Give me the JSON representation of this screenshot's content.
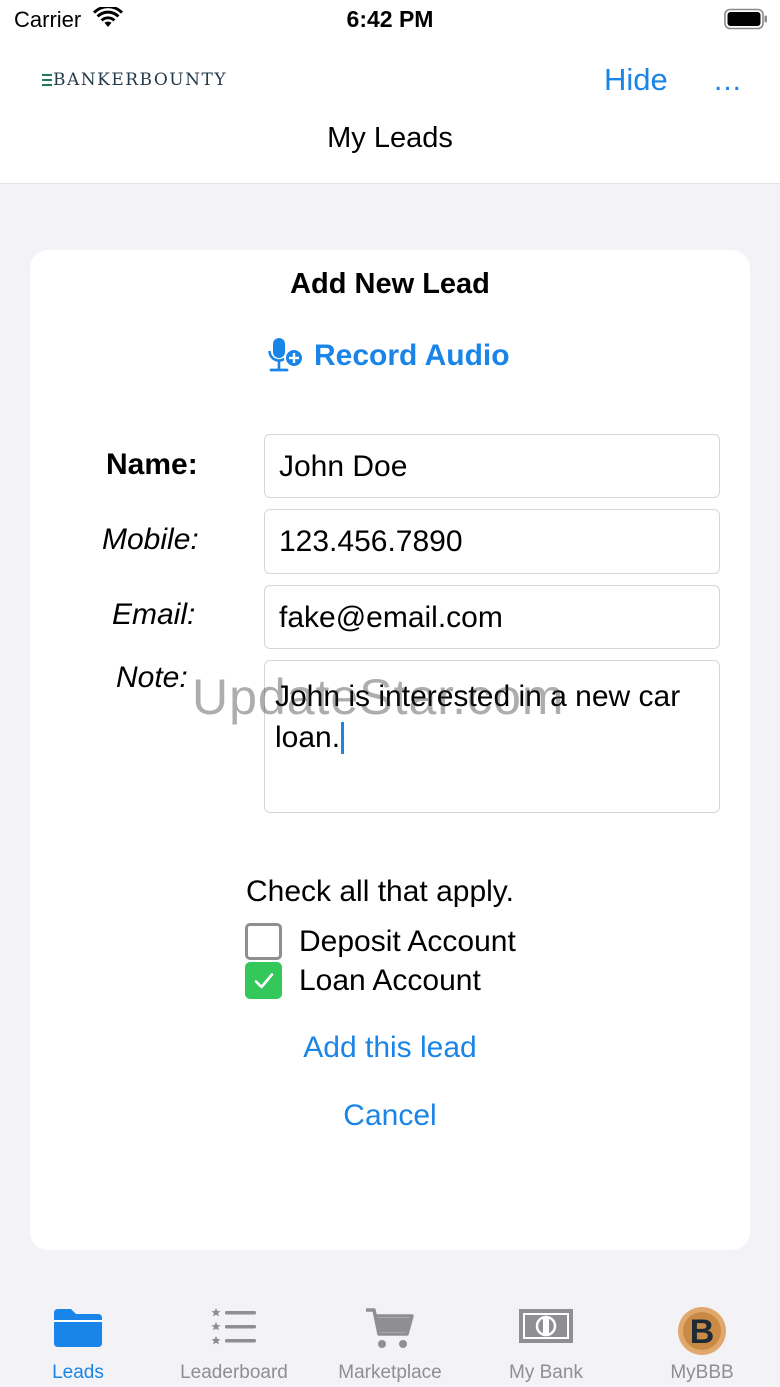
{
  "status_bar": {
    "carrier": "Carrier",
    "time": "6:42 PM"
  },
  "header": {
    "logo_text": "BANKERBOUNTY",
    "hide_label": "Hide",
    "more_label": "...",
    "title": "My Leads"
  },
  "form": {
    "title": "Add New Lead",
    "record_label": "Record Audio",
    "fields": {
      "name": {
        "label": "Name:",
        "value": "John Doe"
      },
      "mobile": {
        "label": "Mobile:",
        "value": "123.456.7890"
      },
      "email": {
        "label": "Email:",
        "value": "fake@email.com"
      },
      "note": {
        "label": "Note:",
        "value": "John is interested in a new car loan."
      }
    },
    "check_title": "Check all that apply.",
    "options": [
      {
        "label": "Deposit Account",
        "checked": false
      },
      {
        "label": "Loan Account",
        "checked": true
      }
    ],
    "add_label": "Add this lead",
    "cancel_label": "Cancel"
  },
  "watermark": "UpdateStar.com",
  "tabs": [
    {
      "label": "Leads",
      "icon": "folder-icon",
      "active": true
    },
    {
      "label": "Leaderboard",
      "icon": "ranked-list-icon",
      "active": false
    },
    {
      "label": "Marketplace",
      "icon": "cart-icon",
      "active": false
    },
    {
      "label": "My Bank",
      "icon": "banknote-icon",
      "active": false
    },
    {
      "label": "MyBBB",
      "icon": "bbb-coin-icon",
      "active": false
    }
  ],
  "colors": {
    "accent": "#1a85e8",
    "checked": "#34c759",
    "tab_inactive": "#8e8e93"
  }
}
